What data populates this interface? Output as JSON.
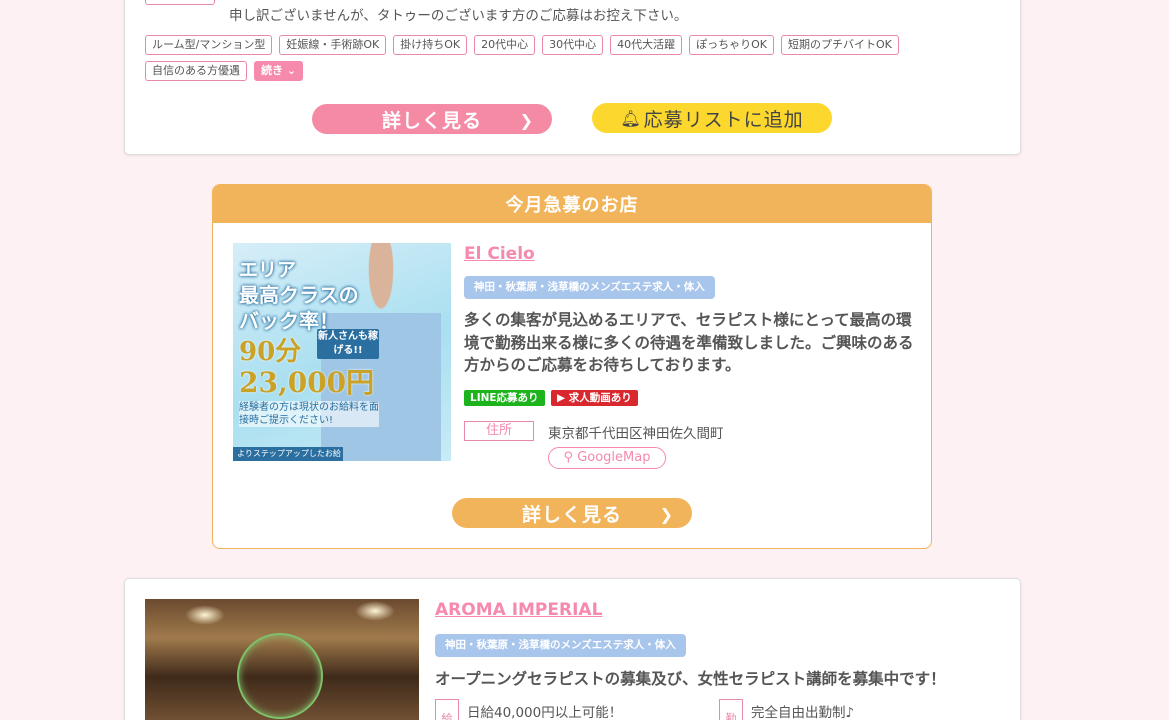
{
  "card1": {
    "note": "申し訳ございませんが、タトゥーのございます方のご応募はお控え下さい。",
    "tags": [
      "ルーム型/マンション型",
      "妊娠線・手術跡OK",
      "掛け持ちOK",
      "20代中心",
      "30代中心",
      "40代大活躍",
      "ぽっちゃりOK",
      "短期のプチバイトOK",
      "自信のある方優遇"
    ],
    "more_label": "続き",
    "detail_button": "詳しく見る",
    "apply_button": "応募リストに追加"
  },
  "card2": {
    "header": "今月急募のお店",
    "shop_name": "El Cielo",
    "area": "神田・秋葉原・浅草橋のメンズエステ求人・体入",
    "description": "多くの集客が見込めるエリアで、セラピスト様にとって最高の環境で勤務出来る様に多くの待遇を準備致しました。ご興味のある方からのご応募をお待ちしております。",
    "badges": {
      "line": "LINE応募あり",
      "video": "求人動画あり"
    },
    "address_label": "住所",
    "address": "東京都千代田区神田佐久間町",
    "map_label": "GoogleMap",
    "detail_button": "詳しく見る",
    "banner": {
      "line1": "エリア",
      "line2": "最高クラスの",
      "line3": "バック率！",
      "line4": "90分",
      "badge": "新人さんも稼げる!!",
      "line5": "23,000円",
      "line6": "経験者の方は現状のお給料を面接時ご提示ください!",
      "line7": "よりステップアップしたお給料へ!"
    }
  },
  "card3": {
    "shop_name": "AROMA IMPERIAL",
    "area": "神田・秋葉原・浅草橋のメンズエステ求人・体入",
    "description": "オープニングセラピストの募集及び、女性セラピスト講師を募集中です！",
    "feature1_label": "給",
    "feature1": "日給40,000円以上可能！",
    "feature2_label": "勤",
    "feature2": "完全自由出勤制♪"
  },
  "icons": {
    "chevron": "chevron-right-icon",
    "bell": "bell-icon",
    "map_marker": "map-marker-icon",
    "youtube": "youtube-icon"
  },
  "colors": {
    "pink": "#f58aac",
    "orange": "#f2b45a",
    "yellow": "#fcd72e",
    "blue_badge": "#a8c5ec"
  }
}
